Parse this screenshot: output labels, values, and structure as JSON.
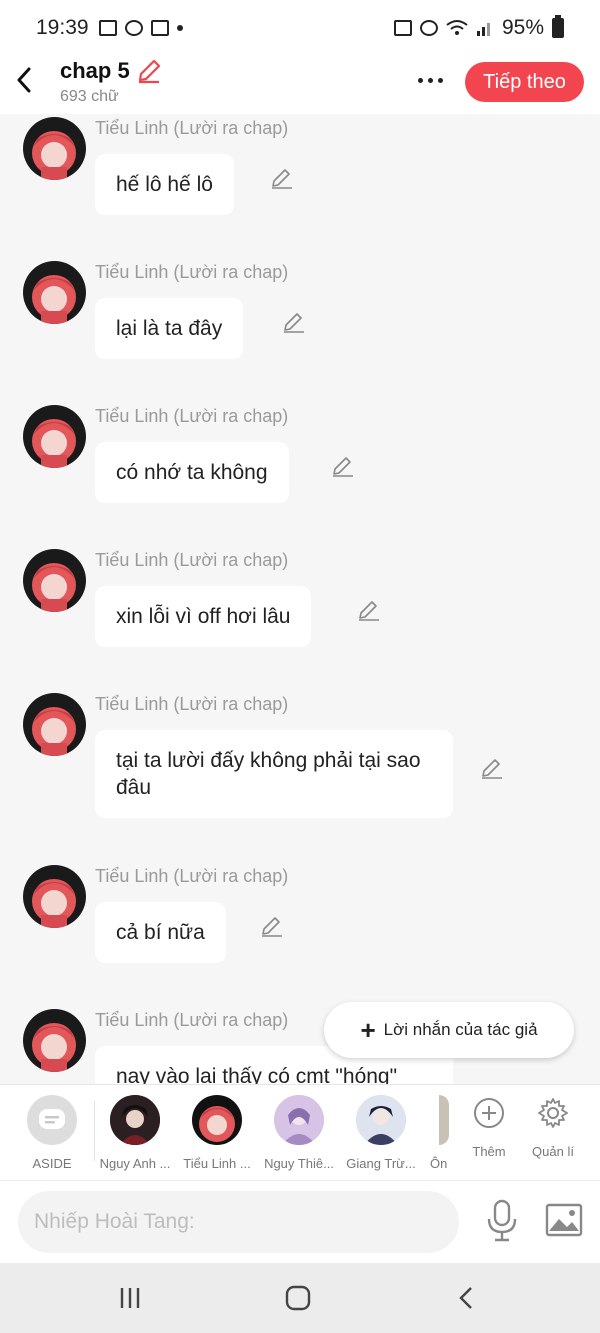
{
  "status": {
    "time": "19:39",
    "battery": "95%"
  },
  "header": {
    "title": "chap 5",
    "word_count": "693 chữ",
    "next_label": "Tiếp theo"
  },
  "messages": [
    {
      "name": "Tiểu Linh (Lười ra chap)",
      "text": "hế lô hế lô"
    },
    {
      "name": "Tiểu Linh (Lười ra chap)",
      "text": "lại là ta đây"
    },
    {
      "name": "Tiểu Linh (Lười ra chap)",
      "text": "có nhớ ta không"
    },
    {
      "name": "Tiểu Linh (Lười ra chap)",
      "text": "xin lỗi vì off hơi lâu"
    },
    {
      "name": "Tiểu Linh (Lười ra chap)",
      "text": "tại ta lười đấy không phải tại sao đâu"
    },
    {
      "name": "Tiểu Linh (Lười ra chap)",
      "text": "cả bí nữa"
    },
    {
      "name": "Tiểu Linh (Lười ra chap)",
      "text": "nay vào lại thấy có cmt \"hóng\""
    }
  ],
  "author_note": {
    "label": "Lời nhắn của tác giả"
  },
  "characters": [
    {
      "label": "ASIDE"
    },
    {
      "label": "Nguy Anh ..."
    },
    {
      "label": "Tiểu Linh ..."
    },
    {
      "label": "Nguy Thiê..."
    },
    {
      "label": "Giang Trừ..."
    },
    {
      "label": "Ôn"
    }
  ],
  "tools": {
    "add_label": "Thêm",
    "manage_label": "Quản lí"
  },
  "input": {
    "placeholder": "Nhiếp Hoài Tang:"
  },
  "colors": {
    "accent": "#f2454f",
    "background": "#f6f6f6"
  },
  "icons": [
    "back-icon",
    "pencil-icon",
    "more-icon",
    "edit-icon",
    "plus-icon",
    "mic-icon",
    "image-icon",
    "gear-icon",
    "add-circle-icon"
  ]
}
